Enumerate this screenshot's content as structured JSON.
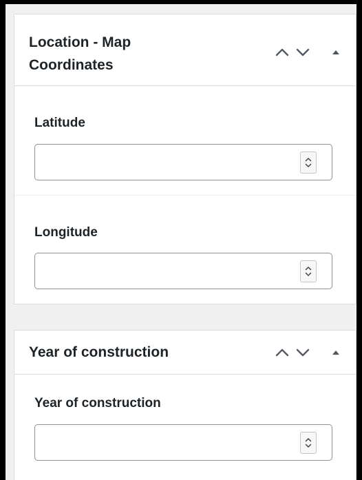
{
  "location_panel": {
    "title": "Location - Map Coordinates",
    "move_up_icon": "chevron-up-icon",
    "move_down_icon": "chevron-down-icon",
    "toggle_icon": "triangle-up-icon",
    "fields": [
      {
        "label": "Latitude",
        "value": "",
        "spinner_icon": "spinner-arrows-icon"
      },
      {
        "label": "Longitude",
        "value": "",
        "spinner_icon": "spinner-arrows-icon"
      }
    ]
  },
  "year_panel": {
    "title": "Year of construction",
    "move_up_icon": "chevron-up-icon",
    "move_down_icon": "chevron-down-icon",
    "toggle_icon": "triangle-up-icon",
    "fields": [
      {
        "label": "Year of construction",
        "value": "",
        "spinner_icon": "spinner-arrows-icon"
      }
    ]
  },
  "colors": {
    "page_background": "#f0f0f1",
    "panel_background": "#ffffff",
    "border": "#dcdcde",
    "input_border": "#8c8f94",
    "icon": "#50575e"
  }
}
